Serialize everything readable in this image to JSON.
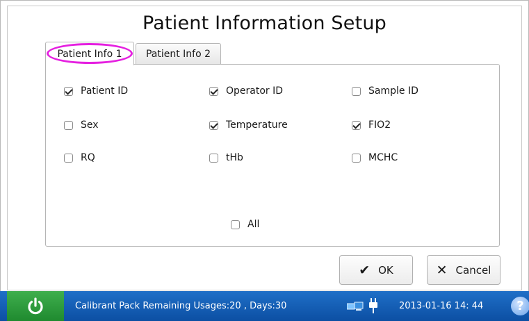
{
  "title": "Patient Information Setup",
  "tabs": [
    {
      "label": "Patient Info 1",
      "active": true
    },
    {
      "label": "Patient Info 2",
      "active": false
    }
  ],
  "options": [
    {
      "label": "Patient ID",
      "checked": true
    },
    {
      "label": "Operator ID",
      "checked": true
    },
    {
      "label": "Sample ID",
      "checked": false
    },
    {
      "label": "Sex",
      "checked": false
    },
    {
      "label": "Temperature",
      "checked": true
    },
    {
      "label": "FIO2",
      "checked": true
    },
    {
      "label": "RQ",
      "checked": false
    },
    {
      "label": "tHb",
      "checked": false
    },
    {
      "label": "MCHC",
      "checked": false
    }
  ],
  "all_option": {
    "label": "All",
    "checked": false
  },
  "buttons": {
    "ok": "OK",
    "cancel": "Cancel"
  },
  "status_bar": {
    "message": "Calibrant Pack Remaining Usages:20 , Days:30",
    "datetime": "2013-01-16  14: 44"
  },
  "colors": {
    "status_bar": "#1160b8",
    "power_button": "#2e9a3e",
    "highlight": "#e520e0"
  },
  "icons": {
    "power": "power-icon",
    "network": "network-icon",
    "plug": "plug-icon",
    "help": "help-icon",
    "ok": "check-icon",
    "cancel": "x-icon"
  }
}
